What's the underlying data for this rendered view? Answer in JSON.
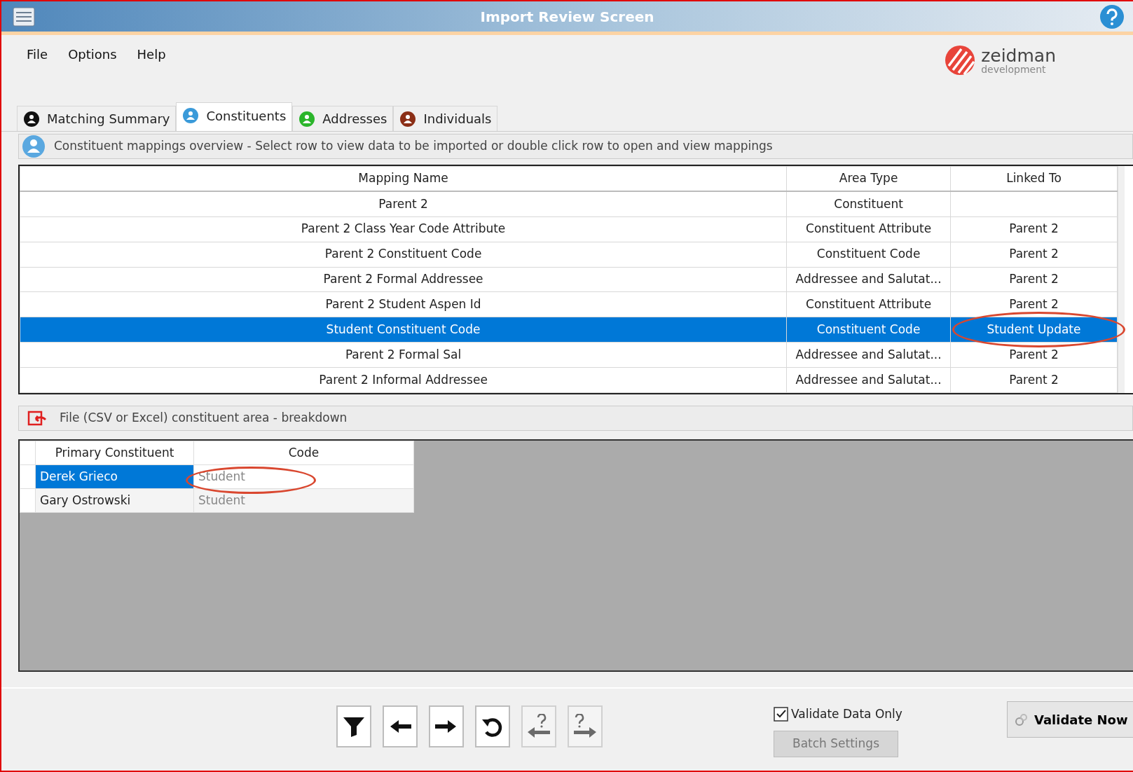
{
  "window": {
    "title": "Import Review Screen"
  },
  "menu": [
    "File",
    "Options",
    "Help"
  ],
  "logo": {
    "name": "zeidman",
    "tagline": "development"
  },
  "tabs": [
    {
      "label": "Matching Summary",
      "selected": false,
      "color": "#111111"
    },
    {
      "label": "Constituents",
      "selected": true,
      "color": "#3a9ad9"
    },
    {
      "label": "Addresses",
      "selected": false,
      "color": "#2bb52b"
    },
    {
      "label": "Individuals",
      "selected": false,
      "color": "#8b2e16"
    }
  ],
  "mappings": {
    "description": "Constituent mappings overview - Select row to view data to be imported or double click row to open and view mappings",
    "columns": [
      "Mapping Name",
      "Area Type",
      "Linked To"
    ],
    "rows": [
      {
        "mapping_name": "Parent 2",
        "area_type": "Constituent",
        "linked_to": "",
        "selected": false,
        "circled": false
      },
      {
        "mapping_name": "Parent 2 Class Year Code Attribute",
        "area_type": "Constituent Attribute",
        "linked_to": "Parent 2",
        "selected": false,
        "circled": false
      },
      {
        "mapping_name": "Parent 2 Constituent Code",
        "area_type": "Constituent Code",
        "linked_to": "Parent 2",
        "selected": false,
        "circled": false
      },
      {
        "mapping_name": "Parent 2 Formal Addressee",
        "area_type": "Addressee and Salutat...",
        "linked_to": "Parent 2",
        "selected": false,
        "circled": false
      },
      {
        "mapping_name": "Parent 2 Student Aspen Id",
        "area_type": "Constituent Attribute",
        "linked_to": "Parent 2",
        "selected": false,
        "circled": false
      },
      {
        "mapping_name": "Student Constituent Code",
        "area_type": "Constituent Code",
        "linked_to": "Student Update",
        "selected": true,
        "circled": true
      },
      {
        "mapping_name": "Parent 2 Formal Sal",
        "area_type": "Addressee and Salutat...",
        "linked_to": "Parent 2",
        "selected": false,
        "circled": false
      },
      {
        "mapping_name": "Parent 2 Informal Addressee",
        "area_type": "Addressee and Salutat...",
        "linked_to": "Parent 2",
        "selected": false,
        "circled": false
      }
    ]
  },
  "breakdown": {
    "title": "File (CSV or Excel) constituent area - breakdown",
    "columns": [
      "Primary Constituent",
      "Code"
    ],
    "rows": [
      {
        "primary_constituent": "Derek Grieco",
        "code": "Student",
        "selected": true,
        "circled": true
      },
      {
        "primary_constituent": "Gary Ostrowski",
        "code": "Student",
        "selected": false,
        "circled": false
      }
    ]
  },
  "toolbar": [
    {
      "kind": "filter",
      "disabled": false
    },
    {
      "kind": "back",
      "disabled": false
    },
    {
      "kind": "forward",
      "disabled": false
    },
    {
      "kind": "undo",
      "disabled": false
    },
    {
      "kind": "prev-question",
      "disabled": true
    },
    {
      "kind": "next-question",
      "disabled": true
    }
  ],
  "validate_only": {
    "label": "Validate Data Only",
    "checked": true
  },
  "batch_settings": {
    "label": "Batch Settings",
    "disabled": true
  },
  "validate_now": {
    "label": "Validate Now"
  }
}
